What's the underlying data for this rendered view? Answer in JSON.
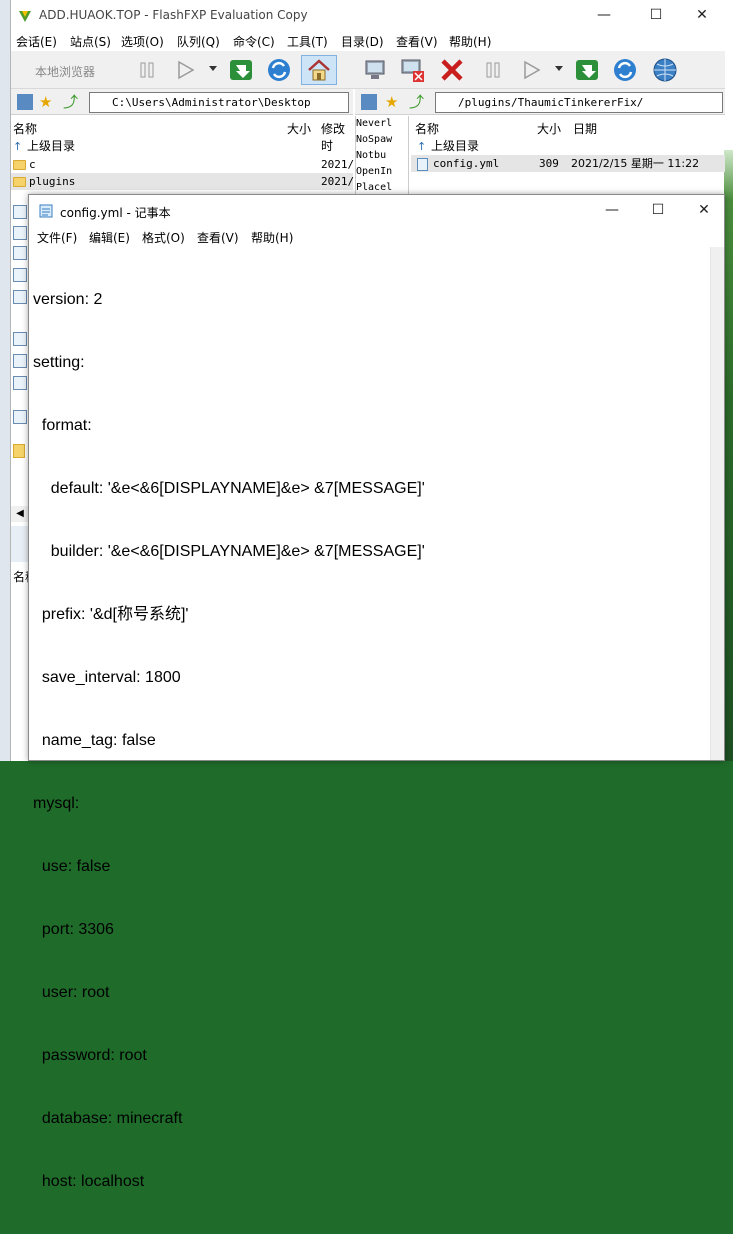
{
  "fxp": {
    "title": "ADD.HUAOK.TOP - FlashFXP Evaluation Copy",
    "menu": [
      "会话(E)",
      "站点(S)",
      "选项(O)",
      "队列(Q)",
      "命令(C)",
      "工具(T)",
      "目录(D)",
      "查看(V)",
      "帮助(H)"
    ],
    "toolbar_local_label": "本地浏览器",
    "local_path": "C:\\Users\\Administrator\\Desktop",
    "remote_path": "/plugins/ThaumicTinkererFix/",
    "local_cols": {
      "name": "名称",
      "size": "大小",
      "modified": "修改时"
    },
    "remote_cols": {
      "name": "名称",
      "size": "大小",
      "date": "日期"
    },
    "local_rows": [
      {
        "name": "上级目录",
        "date": ""
      },
      {
        "name": "c",
        "date": "2021/"
      },
      {
        "name": "plugins",
        "date": "2021/"
      }
    ],
    "remote_rows": [
      {
        "name": "上级目录",
        "size": "",
        "date": ""
      },
      {
        "name": "config.yml",
        "size": "309",
        "date": "2021/2/15 星期一 11:22"
      }
    ],
    "log_lines": [
      "Neverl",
      "NoSpaw",
      "Notbu",
      "OpenIn",
      "Placel"
    ],
    "bottom_left_label": "名称"
  },
  "notepad": {
    "title": "config.yml - 记事本",
    "menu": [
      "文件(F)",
      "编辑(E)",
      "格式(O)",
      "查看(V)",
      "帮助(H)"
    ],
    "lines": [
      "version: 2",
      "setting:",
      "  format:",
      "    default: '&e<&6[DISPLAYNAME]&e> &7[MESSAGE]'",
      "    builder: '&e<&6[DISPLAYNAME]&e> &7[MESSAGE]'",
      "  prefix: '&d[称号系统]'",
      "  save_interval: 1800",
      "  name_tag: false",
      "mysql:",
      "  use: false",
      "  port: 3306",
      "  user: root",
      "  password: root",
      "  database: minecraft",
      "  host: localhost"
    ]
  },
  "colors": {
    "folder": "#f5d36a",
    "selected_row": "#e5e5e5",
    "close_red": "#c42b1c"
  }
}
